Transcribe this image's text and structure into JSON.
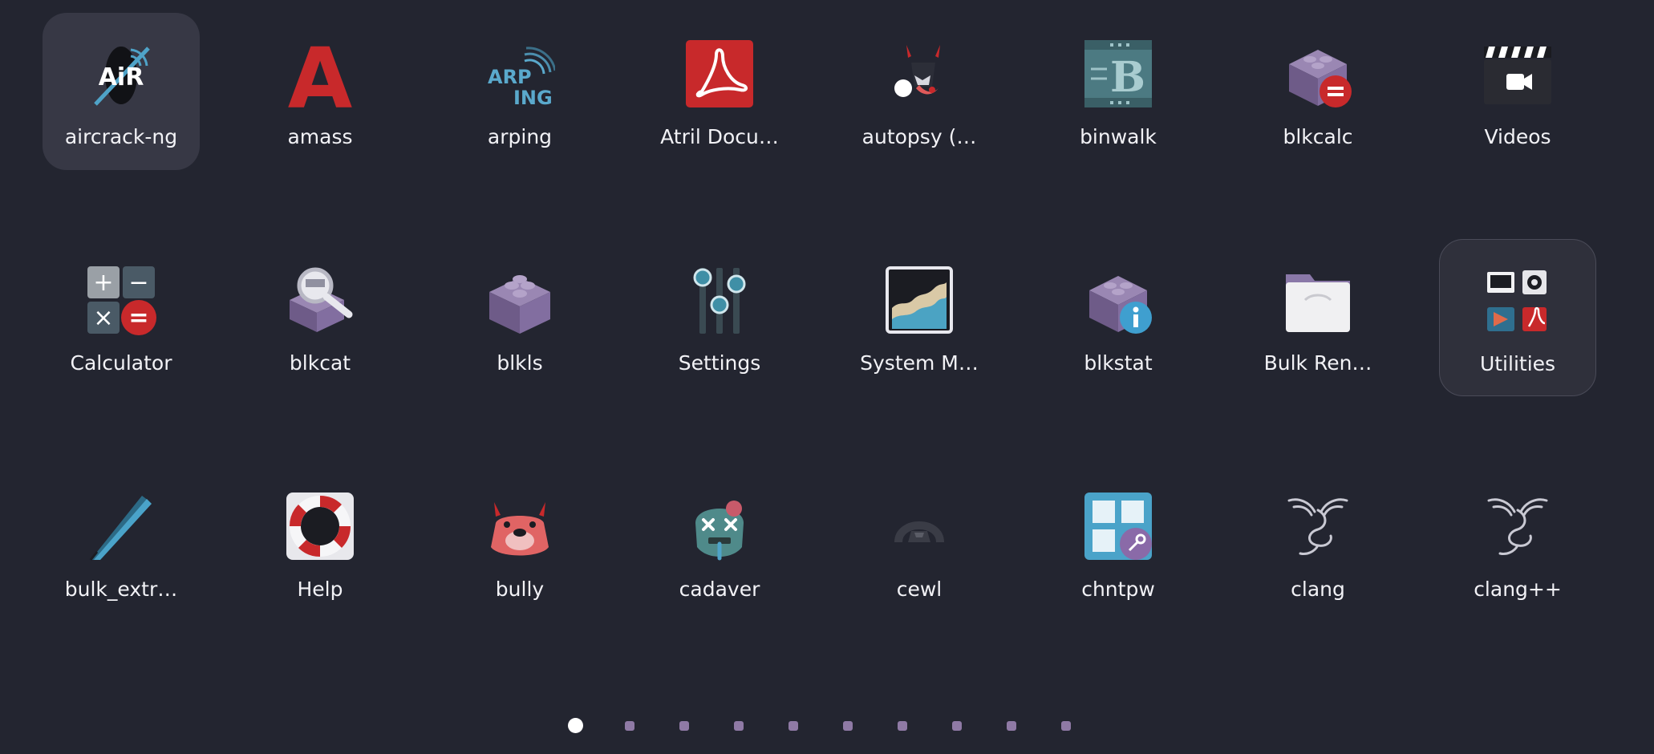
{
  "apps": [
    {
      "label": "aircrack-ng",
      "icon": "aircrack-ng-icon",
      "selected": true
    },
    {
      "label": "amass",
      "icon": "amass-icon"
    },
    {
      "label": "arping",
      "icon": "arping-icon"
    },
    {
      "label": "Atril Docu…",
      "icon": "pdf-document-icon"
    },
    {
      "label": "autopsy (…",
      "icon": "autopsy-icon"
    },
    {
      "label": "binwalk",
      "icon": "binwalk-icon"
    },
    {
      "label": "blkcalc",
      "icon": "blkcalc-icon"
    },
    {
      "label": "Videos",
      "icon": "video-clapper-icon"
    },
    {
      "label": "Calculator",
      "icon": "calculator-icon"
    },
    {
      "label": "blkcat",
      "icon": "blkcat-icon"
    },
    {
      "label": "blkls",
      "icon": "blkls-icon"
    },
    {
      "label": "Settings",
      "icon": "settings-sliders-icon"
    },
    {
      "label": "System M…",
      "icon": "system-monitor-icon"
    },
    {
      "label": "blkstat",
      "icon": "blkstat-icon"
    },
    {
      "label": "Bulk Ren…",
      "icon": "bulk-rename-folder-icon"
    },
    {
      "label": "Utilities",
      "icon": "utilities-folder-icon",
      "folder": true
    },
    {
      "label": "bulk_extr…",
      "icon": "bulk-extractor-tweezers-icon"
    },
    {
      "label": "Help",
      "icon": "help-lifebuoy-icon"
    },
    {
      "label": "bully",
      "icon": "bully-icon"
    },
    {
      "label": "cadaver",
      "icon": "cadaver-zombie-icon"
    },
    {
      "label": "cewl",
      "icon": "cewl-icon"
    },
    {
      "label": "chntpw",
      "icon": "chntpw-icon"
    },
    {
      "label": "clang",
      "icon": "kali-dragon-icon"
    },
    {
      "label": "clang++",
      "icon": "kali-dragon-icon"
    }
  ],
  "pages": {
    "count": 10,
    "current": 1
  },
  "colors": {
    "background": "#232530",
    "selected_tile": "#373845",
    "page_dot": "#8f7aa5",
    "page_dot_active": "#ffffff",
    "label_text": "#f2f2f6"
  },
  "icon_text": {
    "aircrack": "AiR",
    "arping_top": "ARP",
    "arping_bottom": "ING",
    "amass": "A",
    "binwalk": "B",
    "calc_plus": "+",
    "calc_minus": "−",
    "calc_times": "×",
    "calc_equals": "="
  }
}
